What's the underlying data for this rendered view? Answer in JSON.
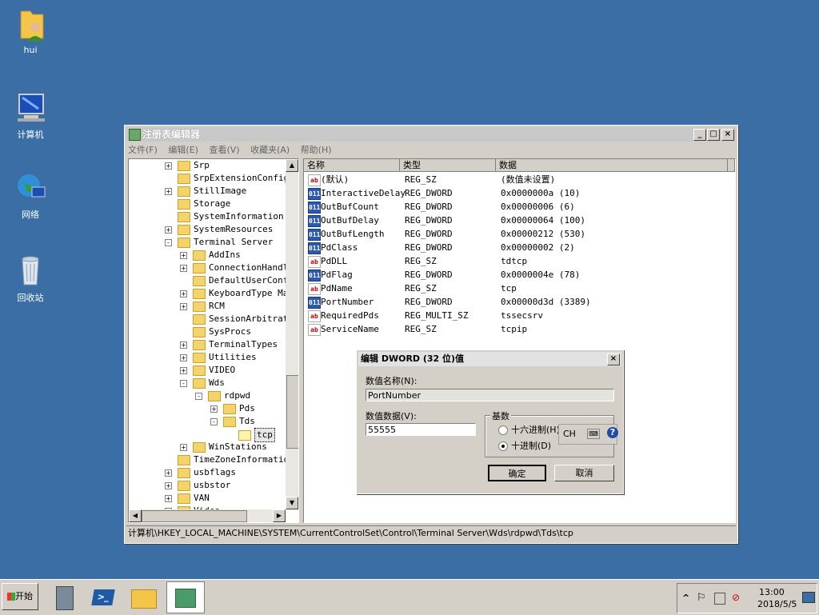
{
  "desktop": {
    "icons": [
      {
        "label": "hui",
        "icon": "user-folder-icon"
      },
      {
        "label": "计算机",
        "icon": "computer-icon"
      },
      {
        "label": "网络",
        "icon": "network-icon"
      },
      {
        "label": "回收站",
        "icon": "recycle-bin-icon"
      }
    ]
  },
  "window": {
    "title": "注册表编辑器",
    "controls": {
      "minimize": "_",
      "maximize": "□",
      "close": "×"
    },
    "menu": [
      "文件(F)",
      "编辑(E)",
      "查看(V)",
      "收藏夹(A)",
      "帮助(H)"
    ],
    "tree": [
      {
        "label": "Srp",
        "exp": "+"
      },
      {
        "label": "SrpExtensionConfig",
        "exp": ""
      },
      {
        "label": "StillImage",
        "exp": "+"
      },
      {
        "label": "Storage",
        "exp": ""
      },
      {
        "label": "SystemInformation",
        "exp": ""
      },
      {
        "label": "SystemResources",
        "exp": "+"
      },
      {
        "label": "Terminal Server",
        "exp": "-"
      },
      {
        "label": "AddIns",
        "exp": "+"
      },
      {
        "label": "ConnectionHandle",
        "exp": "+"
      },
      {
        "label": "DefaultUserConfi",
        "exp": ""
      },
      {
        "label": "KeyboardType Map",
        "exp": "+"
      },
      {
        "label": "RCM",
        "exp": "+"
      },
      {
        "label": "SessionArbitrati",
        "exp": ""
      },
      {
        "label": "SysProcs",
        "exp": ""
      },
      {
        "label": "TerminalTypes",
        "exp": "+"
      },
      {
        "label": "Utilities",
        "exp": "+"
      },
      {
        "label": "VIDEO",
        "exp": "+"
      },
      {
        "label": "Wds",
        "exp": "-"
      },
      {
        "label": "rdpwd",
        "exp": "-"
      },
      {
        "label": "Pds",
        "exp": "+"
      },
      {
        "label": "Tds",
        "exp": "-"
      },
      {
        "label": "tcp",
        "exp": ""
      },
      {
        "label": "WinStations",
        "exp": "+"
      },
      {
        "label": "TimeZoneInformation",
        "exp": ""
      },
      {
        "label": "usbflags",
        "exp": "+"
      },
      {
        "label": "usbstor",
        "exp": "+"
      },
      {
        "label": "VAN",
        "exp": "+"
      },
      {
        "label": "Video",
        "exp": "+"
      }
    ],
    "columns": {
      "name": "名称",
      "type": "类型",
      "data": "数据"
    },
    "values": [
      {
        "icon": "ab",
        "name": "(默认)",
        "type": "REG_SZ",
        "data": "(数值未设置)"
      },
      {
        "icon": "011",
        "name": "InteractiveDelay",
        "type": "REG_DWORD",
        "data": "0x0000000a (10)"
      },
      {
        "icon": "011",
        "name": "OutBufCount",
        "type": "REG_DWORD",
        "data": "0x00000006 (6)"
      },
      {
        "icon": "011",
        "name": "OutBufDelay",
        "type": "REG_DWORD",
        "data": "0x00000064 (100)"
      },
      {
        "icon": "011",
        "name": "OutBufLength",
        "type": "REG_DWORD",
        "data": "0x00000212 (530)"
      },
      {
        "icon": "011",
        "name": "PdClass",
        "type": "REG_DWORD",
        "data": "0x00000002 (2)"
      },
      {
        "icon": "ab",
        "name": "PdDLL",
        "type": "REG_SZ",
        "data": "tdtcp"
      },
      {
        "icon": "011",
        "name": "PdFlag",
        "type": "REG_DWORD",
        "data": "0x0000004e (78)"
      },
      {
        "icon": "ab",
        "name": "PdName",
        "type": "REG_SZ",
        "data": "tcp"
      },
      {
        "icon": "011",
        "name": "PortNumber",
        "type": "REG_DWORD",
        "data": "0x00000d3d (3389)"
      },
      {
        "icon": "ab",
        "name": "RequiredPds",
        "type": "REG_MULTI_SZ",
        "data": "tssecsrv"
      },
      {
        "icon": "ab",
        "name": "ServiceName",
        "type": "REG_SZ",
        "data": "tcpip"
      }
    ],
    "status_path": "计算机\\HKEY_LOCAL_MACHINE\\SYSTEM\\CurrentControlSet\\Control\\Terminal Server\\Wds\\rdpwd\\Tds\\tcp"
  },
  "dialog": {
    "title": "编辑 DWORD (32 位)值",
    "name_label": "数值名称(N):",
    "name_value": "PortNumber",
    "data_label": "数值数据(V):",
    "data_value": "55555",
    "base_label": "基数",
    "hex_label": "十六进制(H)",
    "dec_label": "十进制(D)",
    "ime_label": "CH",
    "ok": "确定",
    "cancel": "取消",
    "close": "×"
  },
  "taskbar": {
    "start_label": "开始",
    "clock_time": "13:00",
    "clock_date": "2018/5/5",
    "tray_expand": "^"
  }
}
